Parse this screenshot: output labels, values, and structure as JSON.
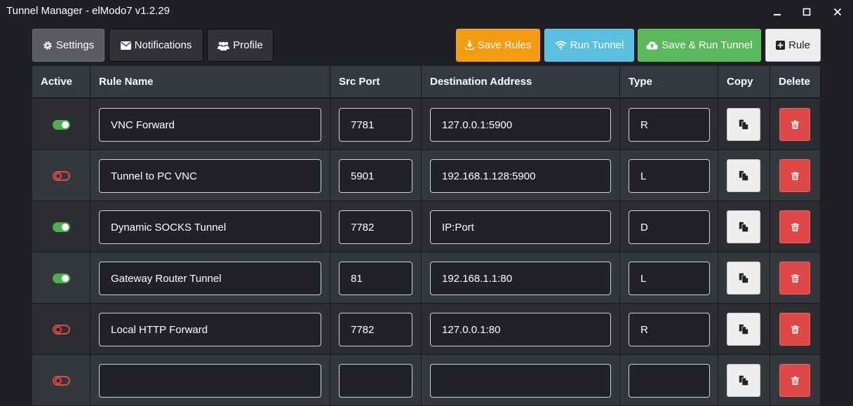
{
  "window": {
    "title": "Tunnel Manager - elModo7 v1.2.29",
    "controls": [
      "minimize-icon",
      "maximize-icon",
      "close-icon"
    ]
  },
  "toolbar": {
    "settings_label": "Settings",
    "notifications_label": "Notifications",
    "profile_label": "Profile",
    "save_rules_label": "Save Rules",
    "run_tunnel_label": "Run Tunnel",
    "save_run_label": "Save & Run Tunnel",
    "add_rule_label": "Rule"
  },
  "colors": {
    "orange": "#f39c12",
    "blue": "#5bc0de",
    "green": "#5cb85c",
    "red": "#e04848",
    "toggle_on": "#4cae4c"
  },
  "table": {
    "headers": {
      "active": "Active",
      "rule_name": "Rule Name",
      "src_port": "Src Port",
      "destination": "Destination Address",
      "type": "Type",
      "copy": "Copy",
      "delete": "Delete"
    },
    "rows": [
      {
        "active": true,
        "name": "VNC Forward",
        "src_port": "7781",
        "destination": "127.0.0.1:5900",
        "type": "R"
      },
      {
        "active": false,
        "name": "Tunnel to PC VNC",
        "src_port": "5901",
        "destination": "192.168.1.128:5900",
        "type": "L"
      },
      {
        "active": true,
        "name": "Dynamic SOCKS Tunnel",
        "src_port": "7782",
        "destination": "IP:Port",
        "type": "D"
      },
      {
        "active": true,
        "name": "Gateway Router Tunnel",
        "src_port": "81",
        "destination": "192.168.1.1:80",
        "type": "L"
      },
      {
        "active": false,
        "name": "Local HTTP Forward",
        "src_port": "7782",
        "destination": "127.0.0.1:80",
        "type": "R"
      },
      {
        "active": false,
        "name": "",
        "src_port": "",
        "destination": "",
        "type": ""
      }
    ]
  }
}
